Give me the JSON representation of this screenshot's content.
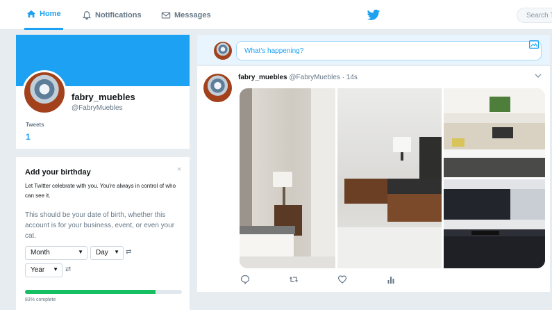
{
  "nav": {
    "home": "Home",
    "notifications": "Notifications",
    "messages": "Messages",
    "search_placeholder": "Search Twitter",
    "accent": "#1da1f2"
  },
  "profile": {
    "name": "fabry_muebles",
    "handle": "@FabryMuebles",
    "tweets_label": "Tweets",
    "tweets_count": "1"
  },
  "birthday": {
    "title": "Add your birthday",
    "close": "×",
    "subtitle": "Let Twitter celebrate with you. You're always in control of who can see it.",
    "description": "This should be your date of birth, whether this account is for your business, event, or even your cat.",
    "month": "Month",
    "day": "Day",
    "year": "Year",
    "progress_fraction": 0.83,
    "progress_label": "83% complete"
  },
  "compose": {
    "placeholder": "What's happening?"
  },
  "tweet": {
    "name": "fabry_muebles",
    "handle": "@FabryMuebles",
    "time": "· 14s",
    "media_count": 4
  },
  "icons": [
    "home-icon",
    "notifications-icon",
    "messages-icon",
    "twitter-bird-icon",
    "image-icon",
    "chevron-down-icon",
    "reply-icon",
    "retweet-icon",
    "like-icon",
    "analytics-icon"
  ]
}
